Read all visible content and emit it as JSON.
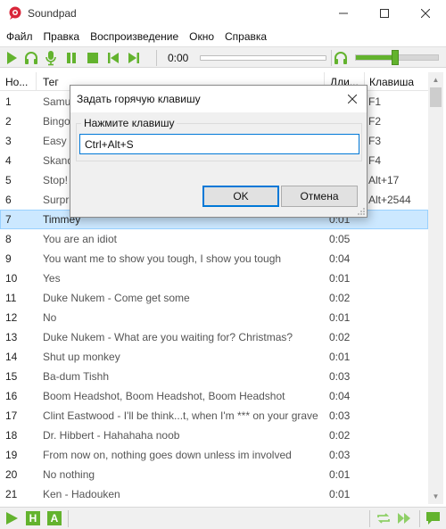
{
  "window": {
    "title": "Soundpad"
  },
  "menu": [
    "Файл",
    "Правка",
    "Воспроизведение",
    "Окно",
    "Справка"
  ],
  "toolbar": {
    "time": "0:00",
    "volume_fraction": 0.48,
    "icons": [
      "play-icon",
      "headphones-icon",
      "microphone-icon",
      "pause-icon",
      "stop-icon",
      "previous-icon",
      "next-icon",
      "headphones-volume-icon"
    ]
  },
  "table": {
    "columns": [
      "Но...",
      "Тег",
      "Дли...",
      "Клавиша"
    ],
    "rows": [
      {
        "num": "1",
        "tag": "Samu",
        "dur": "",
        "key": "F1"
      },
      {
        "num": "2",
        "tag": "Bingo",
        "dur": "",
        "key": "F2"
      },
      {
        "num": "3",
        "tag": "Easy p",
        "dur": "",
        "key": "F3"
      },
      {
        "num": "4",
        "tag": "Skand",
        "dur": "",
        "key": "F4"
      },
      {
        "num": "5",
        "tag": "Stop!",
        "dur": "",
        "key": "Alt+17"
      },
      {
        "num": "6",
        "tag": "Surpr",
        "dur": "",
        "key": "Alt+2544"
      },
      {
        "num": "7",
        "tag": "Timmey",
        "dur": "0:01",
        "key": "",
        "selected": true
      },
      {
        "num": "8",
        "tag": "You are an idiot",
        "dur": "0:05",
        "key": ""
      },
      {
        "num": "9",
        "tag": "You want me to show you tough, I show you tough",
        "dur": "0:04",
        "key": ""
      },
      {
        "num": "10",
        "tag": "Yes",
        "dur": "0:01",
        "key": ""
      },
      {
        "num": "11",
        "tag": "Duke Nukem - Come get some",
        "dur": "0:02",
        "key": ""
      },
      {
        "num": "12",
        "tag": "No",
        "dur": "0:01",
        "key": ""
      },
      {
        "num": "13",
        "tag": "Duke Nukem - What are you waiting for? Christmas?",
        "dur": "0:02",
        "key": ""
      },
      {
        "num": "14",
        "tag": "Shut up monkey",
        "dur": "0:01",
        "key": ""
      },
      {
        "num": "15",
        "tag": "Ba-dum Tishh",
        "dur": "0:03",
        "key": ""
      },
      {
        "num": "16",
        "tag": "Boom Headshot, Boom Headshot, Boom Headshot",
        "dur": "0:04",
        "key": ""
      },
      {
        "num": "17",
        "tag": "Clint Eastwood - I'll be think...t, when I'm *** on your grave",
        "dur": "0:03",
        "key": ""
      },
      {
        "num": "18",
        "tag": "Dr. Hibbert - Hahahaha noob",
        "dur": "0:02",
        "key": ""
      },
      {
        "num": "19",
        "tag": "From now on, nothing goes down unless im involved",
        "dur": "0:03",
        "key": ""
      },
      {
        "num": "20",
        "tag": "No nothing",
        "dur": "0:01",
        "key": ""
      },
      {
        "num": "21",
        "tag": "Ken - Hadouken",
        "dur": "0:01",
        "key": ""
      }
    ]
  },
  "statusbar": {
    "letters": [
      "H",
      "A"
    ]
  },
  "dialog": {
    "title": "Задать горячую клавишу",
    "group_label": "Нажмите клавишу",
    "input_value": "Ctrl+Alt+S",
    "ok_label": "OK",
    "cancel_label": "Отмена"
  },
  "colors": {
    "accent_green": "#63b32e",
    "selection": "#cce8ff",
    "focus_blue": "#0078d7"
  }
}
